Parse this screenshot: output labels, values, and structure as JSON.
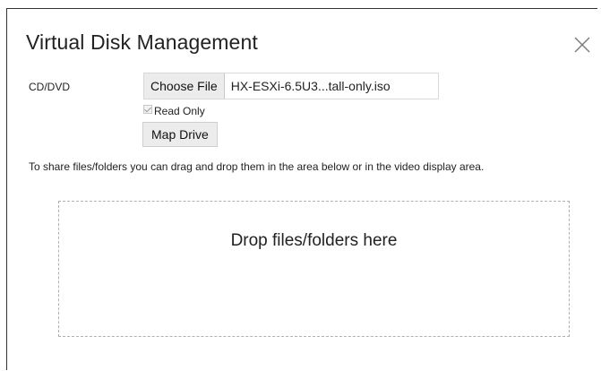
{
  "dialog": {
    "title": "Virtual Disk Management",
    "close_icon": "close-icon"
  },
  "cd_dvd": {
    "label": "CD/DVD",
    "choose_file_label": "Choose File",
    "file_name": "HX-ESXi-6.5U3...tall-only.iso",
    "read_only_label": "Read Only",
    "read_only_checked": true,
    "map_drive_label": "Map Drive"
  },
  "share": {
    "help_text": "To share files/folders you can drag and drop them in the area below or in the video display area.",
    "drop_text": "Drop files/folders here"
  }
}
